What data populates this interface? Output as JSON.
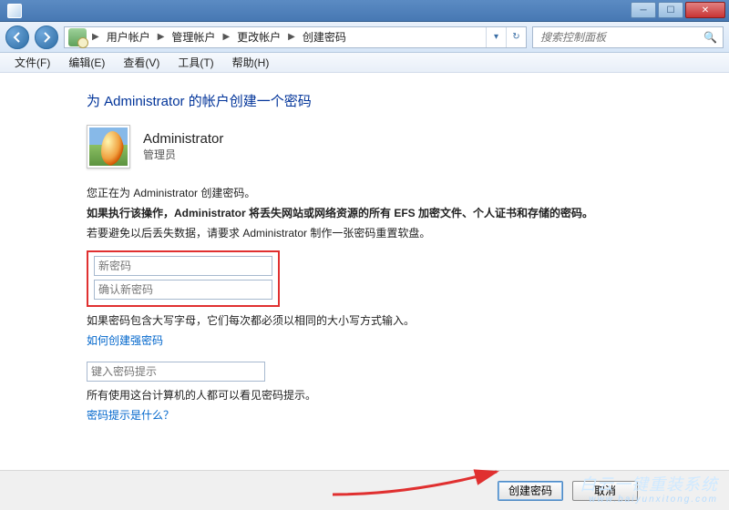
{
  "window": {
    "min_tip": "最小化",
    "max_tip": "最大化",
    "close_tip": "关闭"
  },
  "nav": {
    "back_tip": "后退",
    "fwd_tip": "前进"
  },
  "breadcrumbs": [
    "用户帐户",
    "管理帐户",
    "更改帐户",
    "创建密码"
  ],
  "search": {
    "placeholder": "搜索控制面板"
  },
  "menus": {
    "file": "文件(F)",
    "edit": "编辑(E)",
    "view": "查看(V)",
    "tools": "工具(T)",
    "help": "帮助(H)"
  },
  "page": {
    "title": "为 Administrator 的帐户创建一个密码",
    "user_name": "Administrator",
    "user_role": "管理员",
    "p_creating": "您正在为 Administrator 创建密码。",
    "p_warning": "如果执行该操作，Administrator 将丢失网站或网络资源的所有 EFS 加密文件、个人证书和存储的密码。",
    "p_advice": "若要避免以后丢失数据，请要求 Administrator 制作一张密码重置软盘。",
    "new_pw_placeholder": "新密码",
    "confirm_pw_placeholder": "确认新密码",
    "caps_note": "如果密码包含大写字母，它们每次都必须以相同的大小写方式输入。",
    "link_strong_pw": "如何创建强密码",
    "hint_placeholder": "键入密码提示",
    "hint_visible_note": "所有使用这台计算机的人都可以看见密码提示。",
    "link_hint_what": "密码提示是什么？"
  },
  "buttons": {
    "create": "创建密码",
    "cancel": "取消"
  },
  "watermark": {
    "zh": "白云一键重装系统",
    "en": "www.baiyunxitong.com"
  }
}
